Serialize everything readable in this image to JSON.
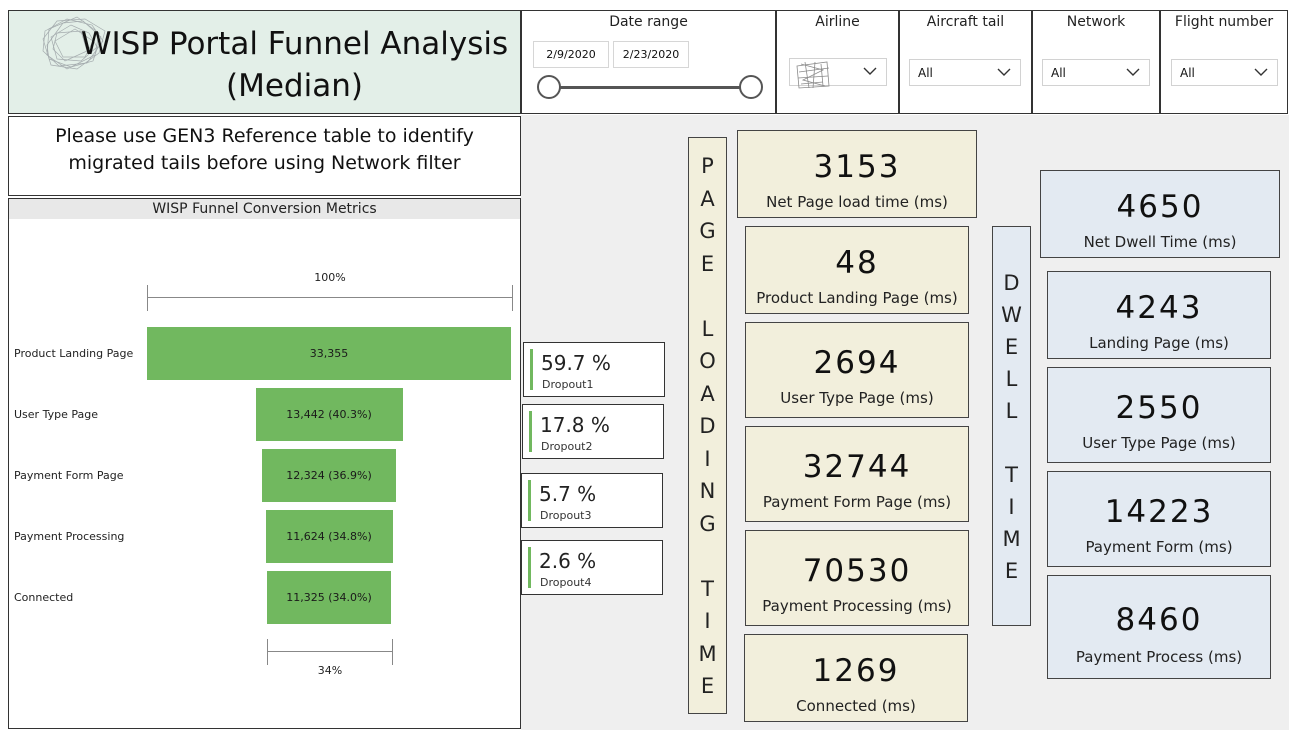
{
  "title": {
    "text": "WISP Portal Funnel Analysis (Median)"
  },
  "notice": {
    "text": "Please use GEN3 Reference table to identify migrated tails before using Network filter"
  },
  "slicers": {
    "date_range": {
      "label": "Date range",
      "start": "2/9/2020",
      "end": "2/23/2020"
    },
    "airline": {
      "label": "Airline",
      "value": ""
    },
    "aircraft_tail": {
      "label": "Aircraft tail",
      "value": "All"
    },
    "network": {
      "label": "Network",
      "value": "All"
    },
    "flight_number": {
      "label": "Flight number",
      "value": "All"
    }
  },
  "funnel": {
    "title": "WISP Funnel Conversion Metrics",
    "top_percent": "100%",
    "bottom_percent": "34%",
    "color": "#71b85f",
    "stages": [
      {
        "label": "Product Landing Page",
        "value_label": "33,355",
        "fraction": 1.0
      },
      {
        "label": "User Type Page",
        "value_label": "13,442 (40.3%)",
        "fraction": 0.403
      },
      {
        "label": "Payment Form Page",
        "value_label": "12,324 (36.9%)",
        "fraction": 0.369
      },
      {
        "label": "Payment Processing",
        "value_label": "11,624 (34.8%)",
        "fraction": 0.348
      },
      {
        "label": "Connected",
        "value_label": "11,325 (34.0%)",
        "fraction": 0.34
      }
    ]
  },
  "dropouts": [
    {
      "value": "59.7 %",
      "label": "Dropout1"
    },
    {
      "value": "17.8 %",
      "label": "Dropout2"
    },
    {
      "value": "5.7 %",
      "label": "Dropout3"
    },
    {
      "value": "2.6 %",
      "label": "Dropout4"
    }
  ],
  "page_loading_label": [
    "P",
    "A",
    "G",
    "E",
    " ",
    "L",
    "O",
    "A",
    "D",
    "I",
    "N",
    "G",
    " ",
    "T",
    "I",
    "M",
    "E"
  ],
  "dwell_label": [
    "D",
    "W",
    "E",
    "L",
    "L",
    " ",
    "T",
    "I",
    "M",
    "E"
  ],
  "page_load_cards": [
    {
      "value": "3153",
      "caption": "Net Page load time (ms)"
    },
    {
      "value": "48",
      "caption": "Product Landing Page (ms)"
    },
    {
      "value": "2694",
      "caption": "User Type Page (ms)"
    },
    {
      "value": "32744",
      "caption": "Payment Form Page (ms)"
    },
    {
      "value": "70530",
      "caption": "Payment Processing (ms)"
    },
    {
      "value": "1269",
      "caption": "Connected (ms)"
    }
  ],
  "dwell_cards": [
    {
      "value": "4650",
      "caption": "Net Dwell Time (ms)"
    },
    {
      "value": "4243",
      "caption": "Landing Page (ms)"
    },
    {
      "value": "2550",
      "caption": "User Type Page (ms)"
    },
    {
      "value": "14223",
      "caption": "Payment Form (ms)"
    },
    {
      "value": "8460",
      "caption": "Payment Process (ms)"
    }
  ],
  "colors": {
    "title_bg": "#e3efe8",
    "tan": "#f2efdc",
    "blue": "#e3eaf2",
    "funnel_green": "#71b85f"
  }
}
